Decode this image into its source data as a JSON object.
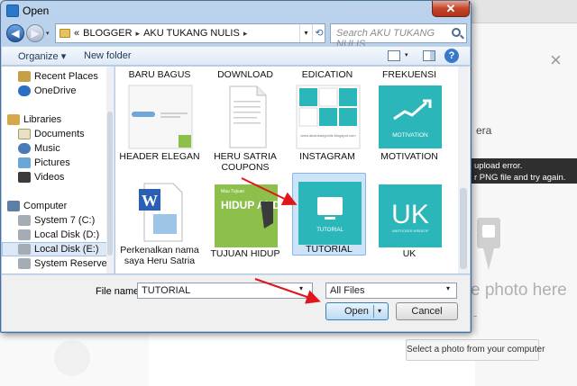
{
  "window": {
    "title": "Open",
    "close_glyph": "✕"
  },
  "nav": {
    "back_glyph": "◀",
    "forward_glyph": "▶",
    "dropdown_glyph": "▾"
  },
  "address": {
    "root_glyph": "«",
    "crumbs": [
      "BLOGGER",
      "AKU TUKANG NULIS"
    ],
    "separator": "▸",
    "dropdown_glyph": "▾",
    "refresh_glyph": "⟲"
  },
  "search": {
    "placeholder": "Search AKU TUKANG NULIS"
  },
  "toolbar": {
    "organize_label": "Organize ▾",
    "new_folder_label": "New folder",
    "help_glyph": "?",
    "view_dropdown_glyph": "▾"
  },
  "navpane": {
    "items": [
      {
        "label": "Recent Places",
        "icon": "recent-places-icon",
        "indent": 1
      },
      {
        "label": "OneDrive",
        "icon": "onedrive-icon",
        "indent": 1
      },
      {
        "label": "Libraries",
        "icon": "libraries-icon",
        "indent": 0
      },
      {
        "label": "Documents",
        "icon": "documents-icon",
        "indent": 1
      },
      {
        "label": "Music",
        "icon": "music-icon",
        "indent": 1
      },
      {
        "label": "Pictures",
        "icon": "pictures-icon",
        "indent": 1
      },
      {
        "label": "Videos",
        "icon": "videos-icon",
        "indent": 1
      },
      {
        "label": "Computer",
        "icon": "computer-icon",
        "indent": 0
      },
      {
        "label": "System 7 (C:)",
        "icon": "drive-icon",
        "indent": 1
      },
      {
        "label": "Local Disk (D:)",
        "icon": "drive-icon",
        "indent": 1
      },
      {
        "label": "Local Disk (E:)",
        "icon": "drive-icon",
        "indent": 1,
        "selected": true
      },
      {
        "label": "System Reserved",
        "icon": "drive-icon",
        "indent": 1
      }
    ]
  },
  "files": {
    "top_row": [
      "BARU BAGUS",
      "DOWNLOAD",
      "EDICATION",
      "FREKUENSI"
    ],
    "row2": [
      {
        "label": "HEADER ELEGAN"
      },
      {
        "label": "HERU SATRIA COUPONS"
      },
      {
        "label": "INSTAGRAM",
        "thumb_caption": "www.akutukangnulis.blogspot.com"
      },
      {
        "label": "MOTIVATION",
        "thumb_caption": "MOTIVATION"
      }
    ],
    "row3": [
      {
        "label": "Perkenalkan nama saya Heru Satria"
      },
      {
        "label": "TUJUAN HIDUP",
        "thumb_caption": "HIDUP ANDA",
        "thumb_small": "Mau Tujuan"
      },
      {
        "label": "TUTORIAL",
        "thumb_caption": "TUTORIAL",
        "selected": true
      },
      {
        "label": "UK",
        "thumb_caption": "UK",
        "thumb_small": "UNSTICKER KREATIF"
      }
    ]
  },
  "form": {
    "filename_label": "File name:",
    "filename_value": "TUTORIAL",
    "filter_value": "All Files",
    "open_label": "Open",
    "cancel_label": "Cancel",
    "dropdown_glyph": "▾"
  },
  "background": {
    "era_text": "era",
    "error_line1": "upload error.",
    "error_line2": "r PNG file and try again.",
    "dropzone_text": "e photo here",
    "or_text": "-",
    "select_button": "Select a photo from your computer",
    "close_glyph": "×"
  },
  "colors": {
    "accent_teal": "#2bb6b9",
    "selection_blue": "#cce3f8",
    "arrow_red": "#e0161b"
  }
}
